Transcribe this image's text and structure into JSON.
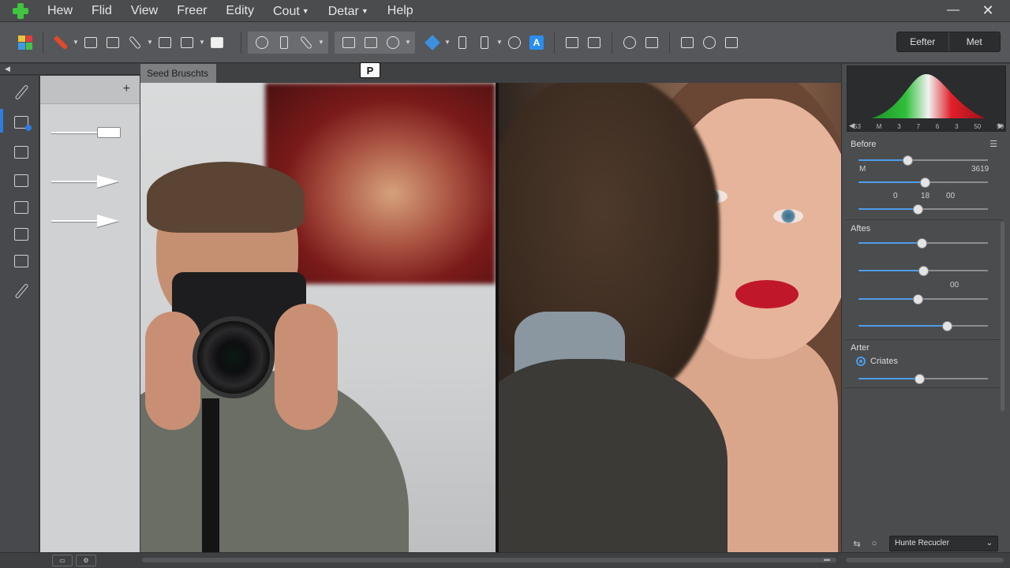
{
  "menu": {
    "items": [
      "Hew",
      "Flid",
      "View",
      "Freer",
      "Edity",
      "Cout",
      "Detar",
      "Help"
    ],
    "with_caret": [
      false,
      false,
      false,
      false,
      false,
      true,
      true,
      false
    ]
  },
  "window": {
    "minimize": "—",
    "close": "✕"
  },
  "toolbar": {
    "mode_left": "Eefter",
    "mode_right": "Met"
  },
  "document": {
    "tab_label": "Seed Bruschts",
    "tooltip": "P"
  },
  "histogram": {
    "ticks": [
      "53",
      "M",
      "3",
      "7",
      "6",
      "3",
      "50",
      "50"
    ],
    "colors": {
      "green": "#2fbf3a",
      "red": "#e0202a",
      "white": "#f2f2f2"
    }
  },
  "panel": {
    "before_title": "Before",
    "before_sliders": [
      {
        "value": 0.38,
        "label_left": "M",
        "label_right": "3619"
      },
      {
        "value": 0.51,
        "labels": [
          "0",
          "18",
          "00"
        ]
      },
      {
        "value": 0.46
      }
    ],
    "after_title": "Aftes",
    "after_sliders": [
      {
        "value": 0.49
      },
      {
        "value": 0.5,
        "label": "00"
      },
      {
        "value": 0.46
      },
      {
        "value": 0.68
      }
    ],
    "after2_title": "Arter",
    "radio_label": "Criates",
    "after2_slider": {
      "value": 0.47
    },
    "preset_value": "Hunte Recucler"
  },
  "colors": {
    "accent": "#2f7de0"
  }
}
